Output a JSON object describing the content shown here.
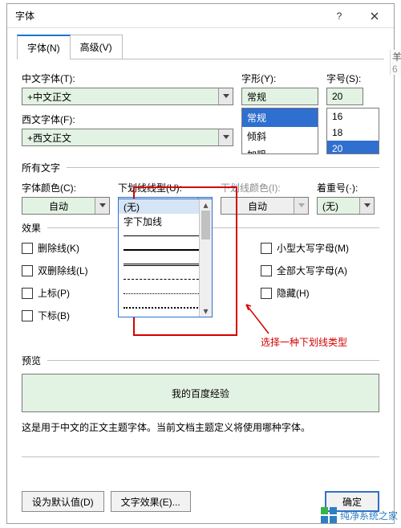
{
  "window": {
    "title": "字体"
  },
  "tabs": {
    "font": "字体(N)",
    "advanced": "高级(V)"
  },
  "labels": {
    "cjk_font": "中文字体(T):",
    "latin_font": "西文字体(F):",
    "style": "字形(Y):",
    "size": "字号(S):",
    "all_text": "所有文字",
    "font_color": "字体颜色(C):",
    "underline_style": "下划线线型(U):",
    "underline_color": "下划线颜色(I):",
    "emphasis": "着重号(·):",
    "effects": "效果",
    "preview": "预览",
    "preview_note": "这是用于中文的正文主题字体。当前文档主题定义将使用哪种字体。"
  },
  "values": {
    "cjk_font": "+中文正文",
    "latin_font": "+西文正文",
    "style": "常规",
    "size": "20",
    "font_color": "自动",
    "underline_style": "(无)",
    "underline_color": "自动",
    "emphasis": "(无)"
  },
  "style_options": [
    "常规",
    "倾斜",
    "加粗"
  ],
  "size_options": [
    "16",
    "18",
    "20"
  ],
  "underline_options": [
    "(无)",
    "字下加线"
  ],
  "effects_left": [
    {
      "id": "strike",
      "label": "删除线(K)"
    },
    {
      "id": "dblstrike",
      "label": "双删除线(L)"
    },
    {
      "id": "super",
      "label": "上标(P)"
    },
    {
      "id": "sub",
      "label": "下标(B)"
    }
  ],
  "effects_right": [
    {
      "id": "smallcaps",
      "label": "小型大写字母(M)"
    },
    {
      "id": "allcaps",
      "label": "全部大写字母(A)"
    },
    {
      "id": "hidden",
      "label": "隐藏(H)"
    }
  ],
  "preview_text": "我的百度经验",
  "buttons": {
    "default": "设为默认值(D)",
    "text_effects": "文字效果(E)...",
    "ok": "确定"
  },
  "annotation": "选择一种下划线类型",
  "watermark": "纯净系统之家",
  "side_stub": {
    "char": "羊",
    "num": "6"
  }
}
